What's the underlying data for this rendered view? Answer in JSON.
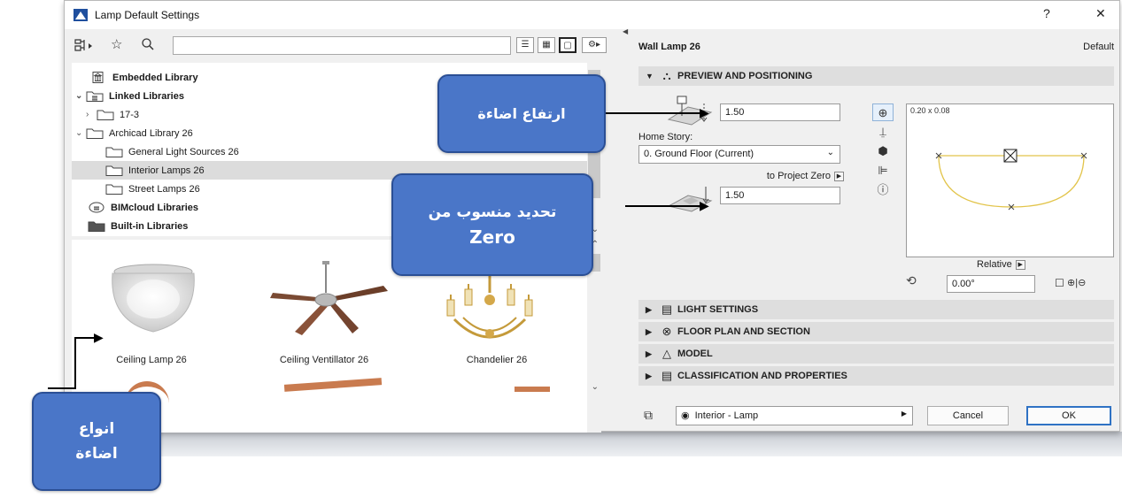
{
  "window": {
    "title": "Lamp Default Settings",
    "help": "?",
    "close": "✕"
  },
  "tree": {
    "items": [
      {
        "label": "Embedded Library",
        "bold": true
      },
      {
        "label": "Linked Libraries",
        "bold": true
      },
      {
        "label": "17-3"
      },
      {
        "label": "Archicad Library 26"
      },
      {
        "label": "General Light Sources 26"
      },
      {
        "label": "Interior Lamps 26",
        "selected": true
      },
      {
        "label": "Street Lamps 26"
      },
      {
        "label": "BIMcloud Libraries",
        "bold": true
      },
      {
        "label": "Built-in Libraries",
        "bold": true
      }
    ]
  },
  "gallery": {
    "items": [
      {
        "label": "Ceiling Lamp 26"
      },
      {
        "label": "Ceiling Ventillator 26"
      },
      {
        "label": "Chandelier 26"
      }
    ]
  },
  "right": {
    "object_name": "Wall Lamp 26",
    "default_label": "Default",
    "sections": {
      "preview": "PREVIEW AND POSITIONING",
      "light": "LIGHT SETTINGS",
      "floor": "FLOOR PLAN AND SECTION",
      "model": "MODEL",
      "classification": "CLASSIFICATION AND PROPERTIES"
    },
    "height_value": "1.50",
    "home_story_label": "Home Story:",
    "home_story_value": "0. Ground Floor (Current)",
    "to_project_zero": "to Project Zero",
    "elevation_value": "1.50",
    "preview_dims": "0.20 x 0.08",
    "relative_label": "Relative",
    "angle_value": "0.00°",
    "layer_value": "Interior - Lamp",
    "cancel": "Cancel",
    "ok": "OK"
  },
  "callouts": {
    "light_height": "ارتفاع اضاءة",
    "zero_line1": "تحديد منسوب من",
    "zero_line2": "Zero",
    "types_line1": "انواع",
    "types_line2": "اضاءة"
  },
  "colors": {
    "callout_fill": "#4a76c8",
    "callout_border": "#2b4f95",
    "ok_border": "#2f72c4",
    "preview_lamp": "#e2c44a"
  }
}
